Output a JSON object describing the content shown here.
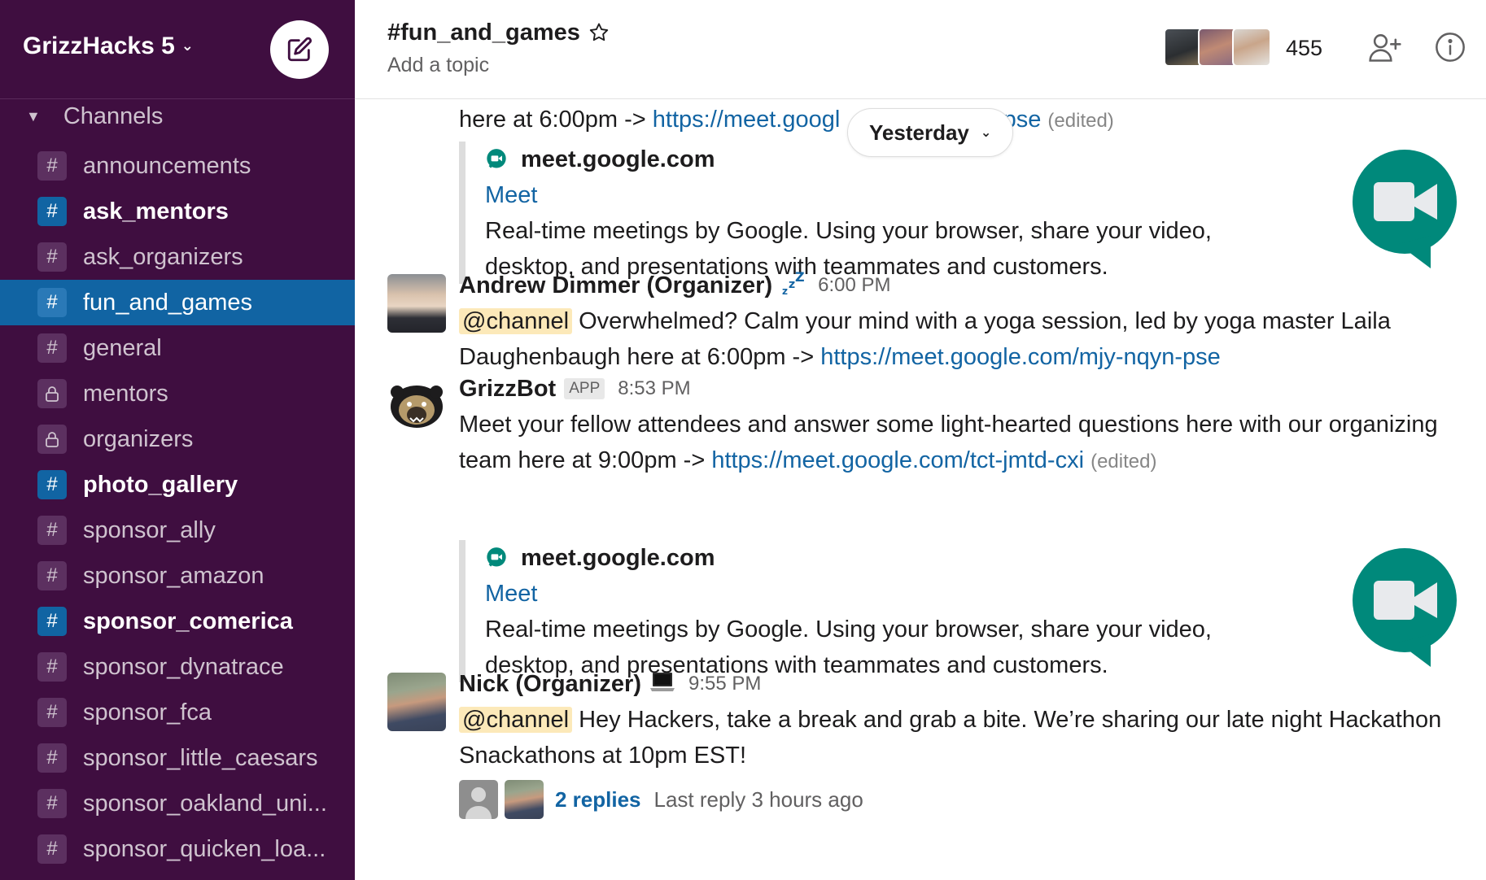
{
  "workspace": {
    "name": "GrizzHacks 5"
  },
  "sidebar": {
    "section_label": "Channels",
    "channels": [
      {
        "name": "announcements",
        "prefix": "#",
        "state": "normal"
      },
      {
        "name": "ask_mentors",
        "prefix": "#",
        "state": "unread"
      },
      {
        "name": "ask_organizers",
        "prefix": "#",
        "state": "normal"
      },
      {
        "name": "fun_and_games",
        "prefix": "#",
        "state": "active"
      },
      {
        "name": "general",
        "prefix": "#",
        "state": "normal"
      },
      {
        "name": "mentors",
        "prefix": "lock",
        "state": "normal"
      },
      {
        "name": "organizers",
        "prefix": "lock",
        "state": "normal"
      },
      {
        "name": "photo_gallery",
        "prefix": "#",
        "state": "unread"
      },
      {
        "name": "sponsor_ally",
        "prefix": "#",
        "state": "normal"
      },
      {
        "name": "sponsor_amazon",
        "prefix": "#",
        "state": "normal"
      },
      {
        "name": "sponsor_comerica",
        "prefix": "#",
        "state": "unread"
      },
      {
        "name": "sponsor_dynatrace",
        "prefix": "#",
        "state": "normal"
      },
      {
        "name": "sponsor_fca",
        "prefix": "#",
        "state": "normal"
      },
      {
        "name": "sponsor_little_caesars",
        "prefix": "#",
        "state": "normal"
      },
      {
        "name": "sponsor_oakland_uni...",
        "prefix": "#",
        "state": "normal"
      },
      {
        "name": "sponsor_quicken_loa...",
        "prefix": "#",
        "state": "normal"
      }
    ]
  },
  "header": {
    "channel_title": "#fun_and_games",
    "topic_placeholder": "Add a topic",
    "member_count": "455"
  },
  "date_divider": {
    "label": "Yesterday"
  },
  "messages": {
    "m0": {
      "text_before": "here at 6:00pm -> ",
      "link": "https://meet.googl",
      "link_tail": "yn-pse",
      "edited": "(edited)",
      "unfurl": {
        "site": "meet.google.com",
        "title": "Meet",
        "description": "Real-time meetings by Google. Using your browser, share your video, desktop, and presentations with teammates and customers."
      }
    },
    "m1": {
      "author": "Andrew Dimmer (Organizer)",
      "status_emoji": "zzz",
      "time": "6:00 PM",
      "mention": "@channel",
      "text": " Overwhelmed? Calm your mind with a yoga session, led by yoga master Laila Daughenbaugh here at 6:00pm -> ",
      "link": "https://meet.google.com/mjy-nqyn-pse"
    },
    "m2": {
      "author": "GrizzBot",
      "badge": "APP",
      "time": "8:53 PM",
      "text": "Meet your fellow attendees and answer some light-hearted questions here with our organizing team here at 9:00pm -> ",
      "link": "https://meet.google.com/tct-jmtd-cxi",
      "edited": "(edited)",
      "unfurl": {
        "site": "meet.google.com",
        "title": "Meet",
        "description": "Real-time meetings by Google. Using your browser, share your video, desktop, and presentations with teammates and customers."
      }
    },
    "m3": {
      "author": "Nick (Organizer)",
      "status_emoji": "laptop",
      "time": "9:55 PM",
      "mention": "@channel",
      "text": " Hey Hackers, take a break and grab a bite. We’re sharing our late night Hackathon Snackathons at 10pm EST!",
      "thread": {
        "replies": "2 replies",
        "last_reply": "Last reply 3 hours ago"
      }
    }
  },
  "colors": {
    "sidebar_bg": "#3f0e40",
    "active_bg": "#1164a3",
    "link": "#1264a3",
    "mention_bg": "#fce9b9",
    "meet_green": "#00897b"
  }
}
